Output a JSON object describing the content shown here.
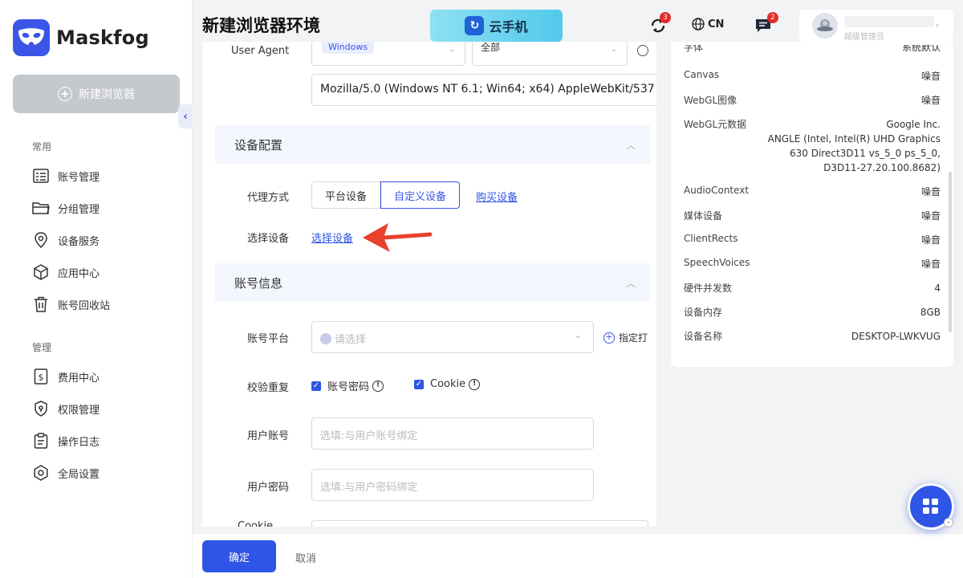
{
  "app": {
    "name": "Maskfog",
    "brand_color": "#3b55e6"
  },
  "sidebar": {
    "new_button": "新建浏览器",
    "groups": [
      {
        "label": "常用",
        "items": [
          {
            "label": "账号管理",
            "icon": "account-list-icon"
          },
          {
            "label": "分组管理",
            "icon": "folder-icon"
          },
          {
            "label": "设备服务",
            "icon": "location-pin-icon"
          },
          {
            "label": "应用中心",
            "icon": "cube-icon"
          },
          {
            "label": "账号回收站",
            "icon": "trash-icon"
          }
        ]
      },
      {
        "label": "管理",
        "items": [
          {
            "label": "费用中心",
            "icon": "dollar-icon"
          },
          {
            "label": "权限管理",
            "icon": "shield-icon"
          },
          {
            "label": "操作日志",
            "icon": "clipboard-icon"
          },
          {
            "label": "全局设置",
            "icon": "settings-icon"
          }
        ]
      }
    ]
  },
  "header": {
    "title": "新建浏览器环境",
    "banner": "云手机",
    "sync_badge": "3",
    "language": "CN",
    "message_badge": "2",
    "user_sub": "超级管理员"
  },
  "form": {
    "ua": {
      "label": "User Agent",
      "os_chip": "Windows",
      "version_select": "全部",
      "value": "Mozilla/5.0 (Windows NT 6.1; Win64; x64) AppleWebKit/537"
    },
    "device_section": {
      "title": "设备配置",
      "proxy_label": "代理方式",
      "proxy_options": [
        "平台设备",
        "自定义设备"
      ],
      "proxy_selected": "自定义设备",
      "buy_link": "购买设备",
      "select_label": "选择设备",
      "select_link": "选择设备"
    },
    "account_section": {
      "title": "账号信息",
      "platform_label": "账号平台",
      "platform_placeholder": "请选择",
      "assign_text": "指定打",
      "dedup_label": "校验重复",
      "dedup_options": [
        {
          "label": "账号密码",
          "checked": true
        },
        {
          "label": "Cookie",
          "checked": true
        }
      ],
      "username_label": "用户账号",
      "username_placeholder": "选填:与用户账号绑定",
      "password_label": "用户密码",
      "password_placeholder": "选填:与用户密码绑定",
      "cookie_label": "Cookie"
    }
  },
  "footer": {
    "ok": "确定",
    "cancel": "取消"
  },
  "fingerprint": [
    {
      "key": "字体",
      "value": "系统默认"
    },
    {
      "key": "Canvas",
      "value": "噪音"
    },
    {
      "key": "WebGL图像",
      "value": "噪音"
    },
    {
      "key": "WebGL元数据",
      "value": "Google Inc.\nANGLE (Intel, Intel(R) UHD Graphics\n630 Direct3D11 vs_5_0 ps_5_0,\nD3D11-27.20.100.8682)"
    },
    {
      "key": "AudioContext",
      "value": "噪音"
    },
    {
      "key": "媒体设备",
      "value": "噪音"
    },
    {
      "key": "ClientRects",
      "value": "噪音"
    },
    {
      "key": "SpeechVoices",
      "value": "噪音"
    },
    {
      "key": "硬件并发数",
      "value": "4"
    },
    {
      "key": "设备内存",
      "value": "8GB"
    },
    {
      "key": "设备名称",
      "value": "DESKTOP-LWKVUG"
    }
  ]
}
